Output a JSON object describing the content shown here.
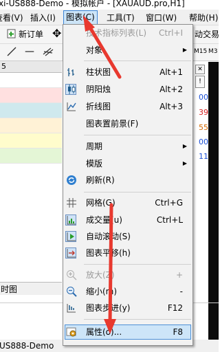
{
  "window": {
    "title": "xi-US888-Demo - 模拟帐户 - [XAUAUD.pro,H1]"
  },
  "menubar": {
    "items": [
      {
        "label": "查看(V)"
      },
      {
        "label": "插入(I)"
      },
      {
        "label": "图表(C)"
      },
      {
        "label": "工具(T)"
      },
      {
        "label": "窗口(W)"
      },
      {
        "label": "帮助(H)"
      }
    ]
  },
  "toolbar": {
    "new_order": "新订单",
    "algo_trading": "动交易"
  },
  "toolbar2": {
    "timeframes": [
      "M15",
      "M3"
    ]
  },
  "panel": {
    "header": "5",
    "right_values": [
      "00",
      "39",
      "55",
      "00",
      "11"
    ],
    "right_value_colors": [
      "#1a4fd6",
      "#d62020",
      "#d66a00",
      "#1a4fd6",
      "#1a4fd6"
    ]
  },
  "chart_menu": {
    "items": [
      {
        "id": "indicator-list",
        "label": "技术指标列表(L)",
        "shortcut": "Ctrl+I",
        "enabled": false,
        "icon": "none-icon"
      },
      {
        "id": "objects",
        "label": "对象",
        "submenu": true,
        "enabled": true,
        "icon": "none-icon"
      },
      {
        "id": "bar-chart",
        "label": "柱状图",
        "shortcut": "Alt+1",
        "enabled": true,
        "icon": "bar-chart-icon"
      },
      {
        "id": "candlesticks",
        "label": "阴阳烛",
        "shortcut": "Alt+2",
        "enabled": true,
        "icon": "candlestick-icon",
        "checked": true
      },
      {
        "id": "line-chart",
        "label": "折线图",
        "shortcut": "Alt+3",
        "enabled": true,
        "icon": "line-chart-icon"
      },
      {
        "id": "foreground",
        "label": "图表置前景(F)",
        "enabled": true,
        "icon": "none-icon"
      },
      {
        "id": "periodicity",
        "label": "周期",
        "submenu": true,
        "enabled": true,
        "icon": "none-icon"
      },
      {
        "id": "template",
        "label": "模版",
        "submenu": true,
        "enabled": true,
        "icon": "none-icon"
      },
      {
        "id": "refresh",
        "label": "刷新(R)",
        "enabled": true,
        "icon": "refresh-icon"
      },
      {
        "id": "grid",
        "label": "网格(G)",
        "shortcut": "Ctrl+G",
        "enabled": true,
        "icon": "grid-icon"
      },
      {
        "id": "volumes",
        "label": "成交量(u)",
        "shortcut": "Ctrl+L",
        "enabled": true,
        "icon": "volume-icon",
        "checked": true
      },
      {
        "id": "autoscroll",
        "label": "自动滚动(S)",
        "enabled": true,
        "icon": "autoscroll-icon",
        "checked": true
      },
      {
        "id": "chart-shift",
        "label": "图表平移(h)",
        "enabled": true,
        "icon": "chart-shift-icon",
        "checked": true
      },
      {
        "id": "zoom-in",
        "label": "放大(Z)",
        "shortcut": "+",
        "enabled": false,
        "icon": "zoom-in-icon"
      },
      {
        "id": "zoom-out",
        "label": "缩小(m)",
        "shortcut": "-",
        "enabled": true,
        "icon": "zoom-out-icon"
      },
      {
        "id": "step-by-step",
        "label": "图表步进(y)",
        "shortcut": "F12",
        "enabled": true,
        "icon": "step-icon"
      },
      {
        "id": "properties",
        "label": "属性(o)...",
        "shortcut": "F8",
        "enabled": true,
        "icon": "properties-icon",
        "highlighted": true
      }
    ]
  },
  "bottom_tab": {
    "label": "时图"
  },
  "status_bar": {
    "text": "US888-Demo"
  },
  "colors": {
    "menu_highlight": "#cde5f8",
    "arrow": "#e8392f"
  }
}
